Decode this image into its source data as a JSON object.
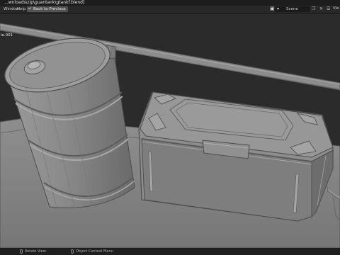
{
  "window": {
    "title": "...wnloads\\zip\\guantank\\gtankf.blend]"
  },
  "menubar": {
    "items": [
      "Window",
      "Help"
    ],
    "back_button": "Back to Previous",
    "scene_label": "Scene",
    "view_layer_label": "Vie"
  },
  "viewport": {
    "object_name": "le.001"
  },
  "statusbar": {
    "rotate_view": "Rotate View",
    "object_context_menu": "Object Context Menu"
  },
  "icons": [
    "back-icon",
    "scene-icon",
    "copy-icon",
    "close-icon",
    "layers-icon",
    "mouse-icon"
  ],
  "colors": {
    "background": "#2b2b2b",
    "mesh": "#8a8a8a",
    "menu_bar": "#282828",
    "button": "#545454"
  }
}
